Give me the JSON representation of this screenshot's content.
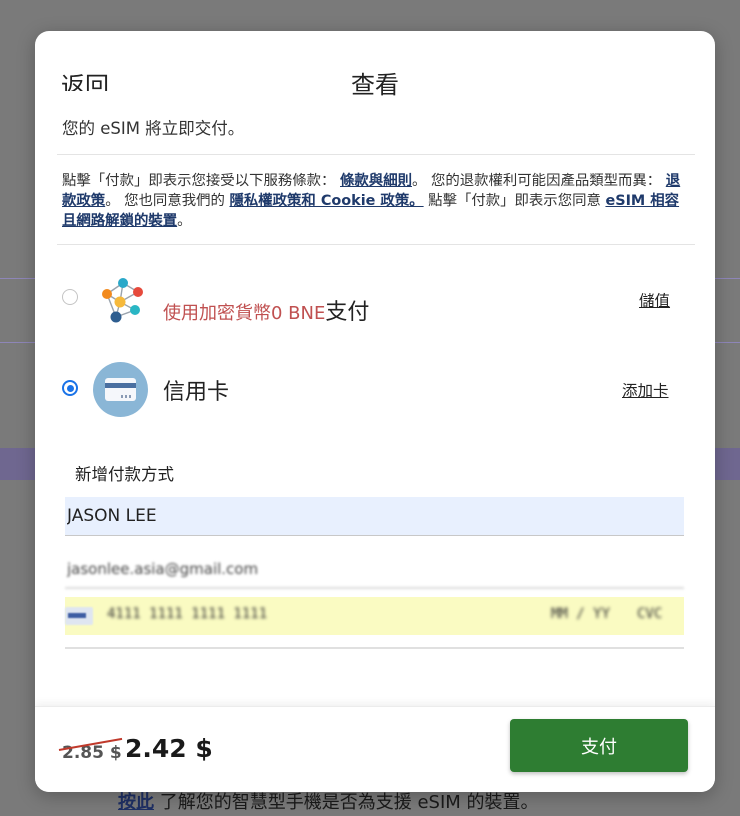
{
  "backdrop": {
    "footer_link": "按此",
    "footer_text": " 了解您的智慧型手機是否為支援 eSIM 的裝置。"
  },
  "modal": {
    "back_label": "返回",
    "title": "查看",
    "delivery_note": "您的 eSIM 將立即交付。",
    "terms": {
      "part1": "點擊「付款」即表示您接受以下服務條款：",
      "link_terms": "條款與細則",
      "part2": "。 您的退款權利可能因產品類型而異：",
      "link_refund": "退款政策",
      "part3": "。 您也同意我們的 ",
      "link_privacy": "隱私權政策和 Cookie 政策。",
      "part4": " 點擊「付款」即表示您同意 ",
      "link_devices": "eSIM 相容且網路解鎖的裝置",
      "part5": "。"
    },
    "crypto_option": {
      "label": "使用加密貨幣0 BNE",
      "pay": "支付",
      "action": "儲值",
      "selected": false
    },
    "card_option": {
      "label": "信用卡",
      "action": "添加卡",
      "selected": true
    },
    "add_method_title": "新增付款方式",
    "form": {
      "name_value": "JASON LEE",
      "email_value": "jasonlee.asia@gmail.com",
      "card_number": "4111 1111 1111 1111",
      "card_expiry": "MM / YY",
      "card_cvc": "CVC"
    },
    "footer": {
      "old_price": "2.85 $",
      "new_price": "2.42 $",
      "pay_button": "支付"
    }
  },
  "colors": {
    "pay_button": "#2e7d32",
    "link": "#1f3a6b",
    "radio_selected": "#1a73e8",
    "crypto_text": "#c05050",
    "strike": "#c0392b"
  }
}
